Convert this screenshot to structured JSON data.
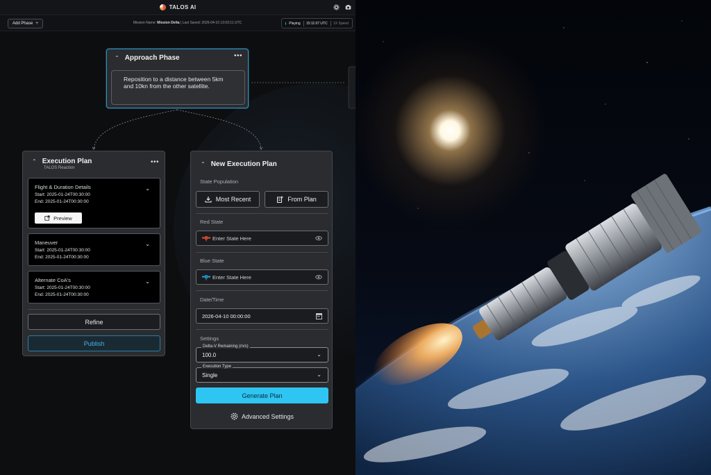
{
  "app": {
    "title": "TALOS AI",
    "add_phase_label": "Add Phase",
    "mission_name_label": "Mission Name:",
    "mission_name": "Mission Delta",
    "last_saved_label": "Last Saved:",
    "last_saved": "2026-04-10 13:03:11 UTC",
    "status": "Playing",
    "clock": "15:11:07 UTC",
    "speed": "1X Speed"
  },
  "approach": {
    "title": "Approach Phase",
    "description": "Reposition to a distance between 5km and 10kn from the other satellite."
  },
  "execution_plan": {
    "title": "Execution Plan",
    "subtitle": "TALOS Reaction",
    "items": [
      {
        "title": "Flight & Duration Details",
        "start": "Start: 2025-01-24T00:30:00",
        "end": "End: 2025-01-24T00:30:00",
        "preview_label": "Preview"
      },
      {
        "title": "Maneuver",
        "start": "Start: 2025-01-24T00:30:00",
        "end": "End: 2025-01-24T00:30:00"
      },
      {
        "title": "Alternate CoA's",
        "start": "Start: 2025-01-24T00:30:00",
        "end": "End: 2025-01-24T00:30:00"
      }
    ],
    "refine_label": "Refine",
    "publish_label": "Publish"
  },
  "new_execution_plan": {
    "title": "New Execution Plan",
    "state_population_label": "State Population",
    "most_recent_label": "Most Recent",
    "from_plan_label": "From Plan",
    "red_state_label": "Red State",
    "red_state_placeholder": "Enter State Here",
    "blue_state_label": "Blue State",
    "blue_state_placeholder": "Enter State Here",
    "datetime_label": "Date/Time",
    "datetime_value": "2026-04-10 00:00:00",
    "settings_label": "Settings",
    "delta_v_label": "Delta-V Remaining (m/s)",
    "delta_v_value": "100.0",
    "execution_type_label": "Execution Type",
    "execution_type_value": "Single",
    "generate_label": "Generate Plan",
    "advanced_label": "Advanced Settings"
  },
  "colors": {
    "accent": "#2ec5f2",
    "red_satellite": "#e2553a",
    "blue_satellite": "#2ea0d8",
    "status_dot": "#37d16b"
  }
}
